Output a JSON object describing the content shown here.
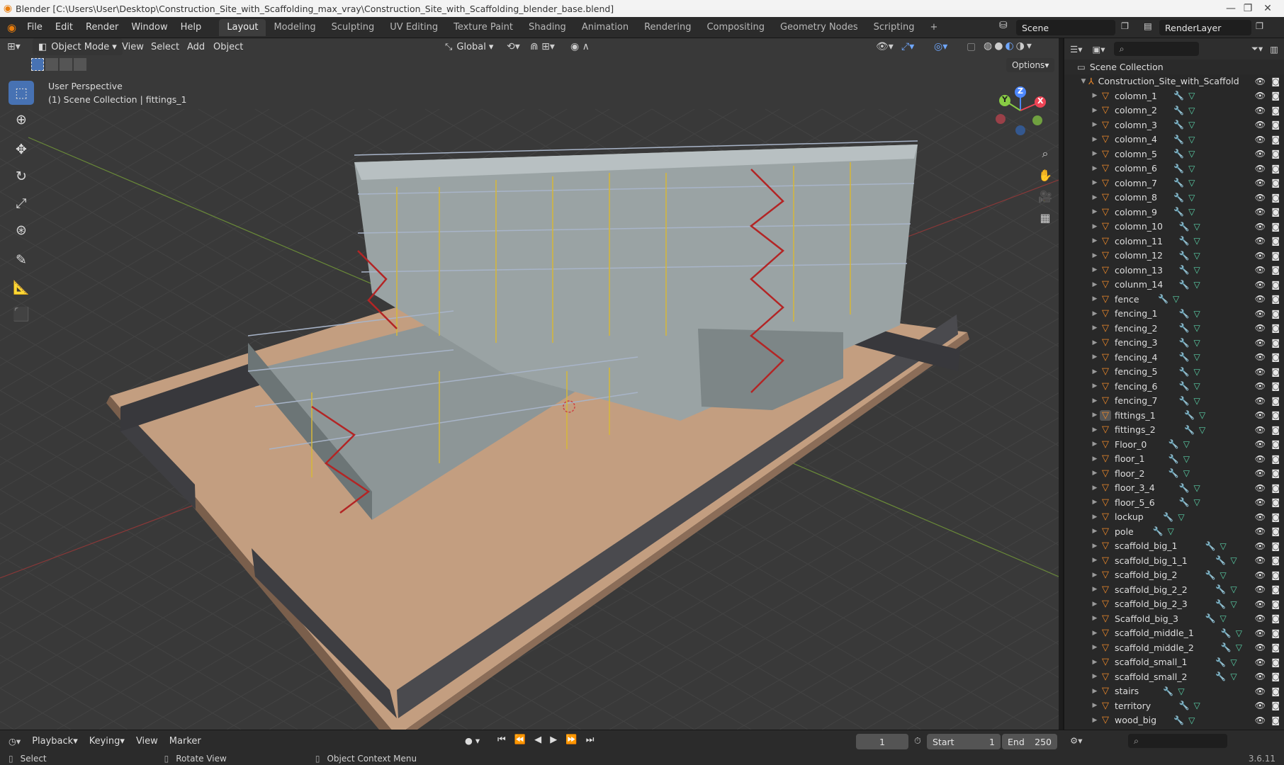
{
  "window": {
    "title": "Blender [C:\\Users\\User\\Desktop\\Construction_Site_with_Scaffolding_max_vray\\Construction_Site_with_Scaffolding_blender_base.blend]",
    "minimize": "—",
    "maximize": "❐",
    "close": "✕"
  },
  "menubar": {
    "items": [
      "File",
      "Edit",
      "Render",
      "Window",
      "Help"
    ],
    "workspaces": [
      "Layout",
      "Modeling",
      "Sculpting",
      "UV Editing",
      "Texture Paint",
      "Shading",
      "Animation",
      "Rendering",
      "Compositing",
      "Geometry Nodes",
      "Scripting"
    ],
    "active_workspace": "Layout",
    "add_tab": "+",
    "scene": "Scene",
    "view_layer": "RenderLayer"
  },
  "viewport_header": {
    "mode": "Object Mode",
    "menus": [
      "View",
      "Select",
      "Add",
      "Object"
    ],
    "transform_orientation": "Global",
    "options": "Options"
  },
  "viewport": {
    "perspective": "User Perspective",
    "collection_info": "(1) Scene Collection | fittings_1",
    "gizmo": {
      "x": "X",
      "y": "Y",
      "z": "Z"
    }
  },
  "outliner": {
    "root": "Scene Collection",
    "collection": "Construction_Site_with_Scaffold",
    "items": [
      "colomn_1",
      "colomn_2",
      "colomn_3",
      "colomn_4",
      "colomn_5",
      "colomn_6",
      "colomn_7",
      "colomn_8",
      "colomn_9",
      "colomn_10",
      "colomn_11",
      "colomn_12",
      "colomn_13",
      "colunm_14",
      "fence",
      "fencing_1",
      "fencing_2",
      "fencing_3",
      "fencing_4",
      "fencing_5",
      "fencing_6",
      "fencing_7",
      "fittings_1",
      "fittings_2",
      "Floor_0",
      "floor_1",
      "floor_2",
      "floor_3_4",
      "floor_5_6",
      "lockup",
      "pole",
      "scaffold_big_1",
      "scaffold_big_1_1",
      "scaffold_big_2",
      "scaffold_big_2_2",
      "scaffold_big_2_3",
      "Scaffold_big_3",
      "scaffold_middle_1",
      "scaffold_middle_2",
      "scaffold_small_1",
      "scaffold_small_2",
      "stairs",
      "territory",
      "wood_big"
    ],
    "selected_item": "fittings_1"
  },
  "timeline": {
    "menus": [
      "Playback",
      "Keying",
      "View",
      "Marker"
    ],
    "current_frame": "1",
    "start_label": "Start",
    "start": "1",
    "end_label": "End",
    "end": "250"
  },
  "statusbar": {
    "select": "Select",
    "rotate": "Rotate View",
    "context_menu": "Object Context Menu",
    "version": "3.6.11"
  },
  "colors": {
    "accent": "#4772b3",
    "mesh_icon": "#f08a2a",
    "ground": "#c9a384"
  }
}
